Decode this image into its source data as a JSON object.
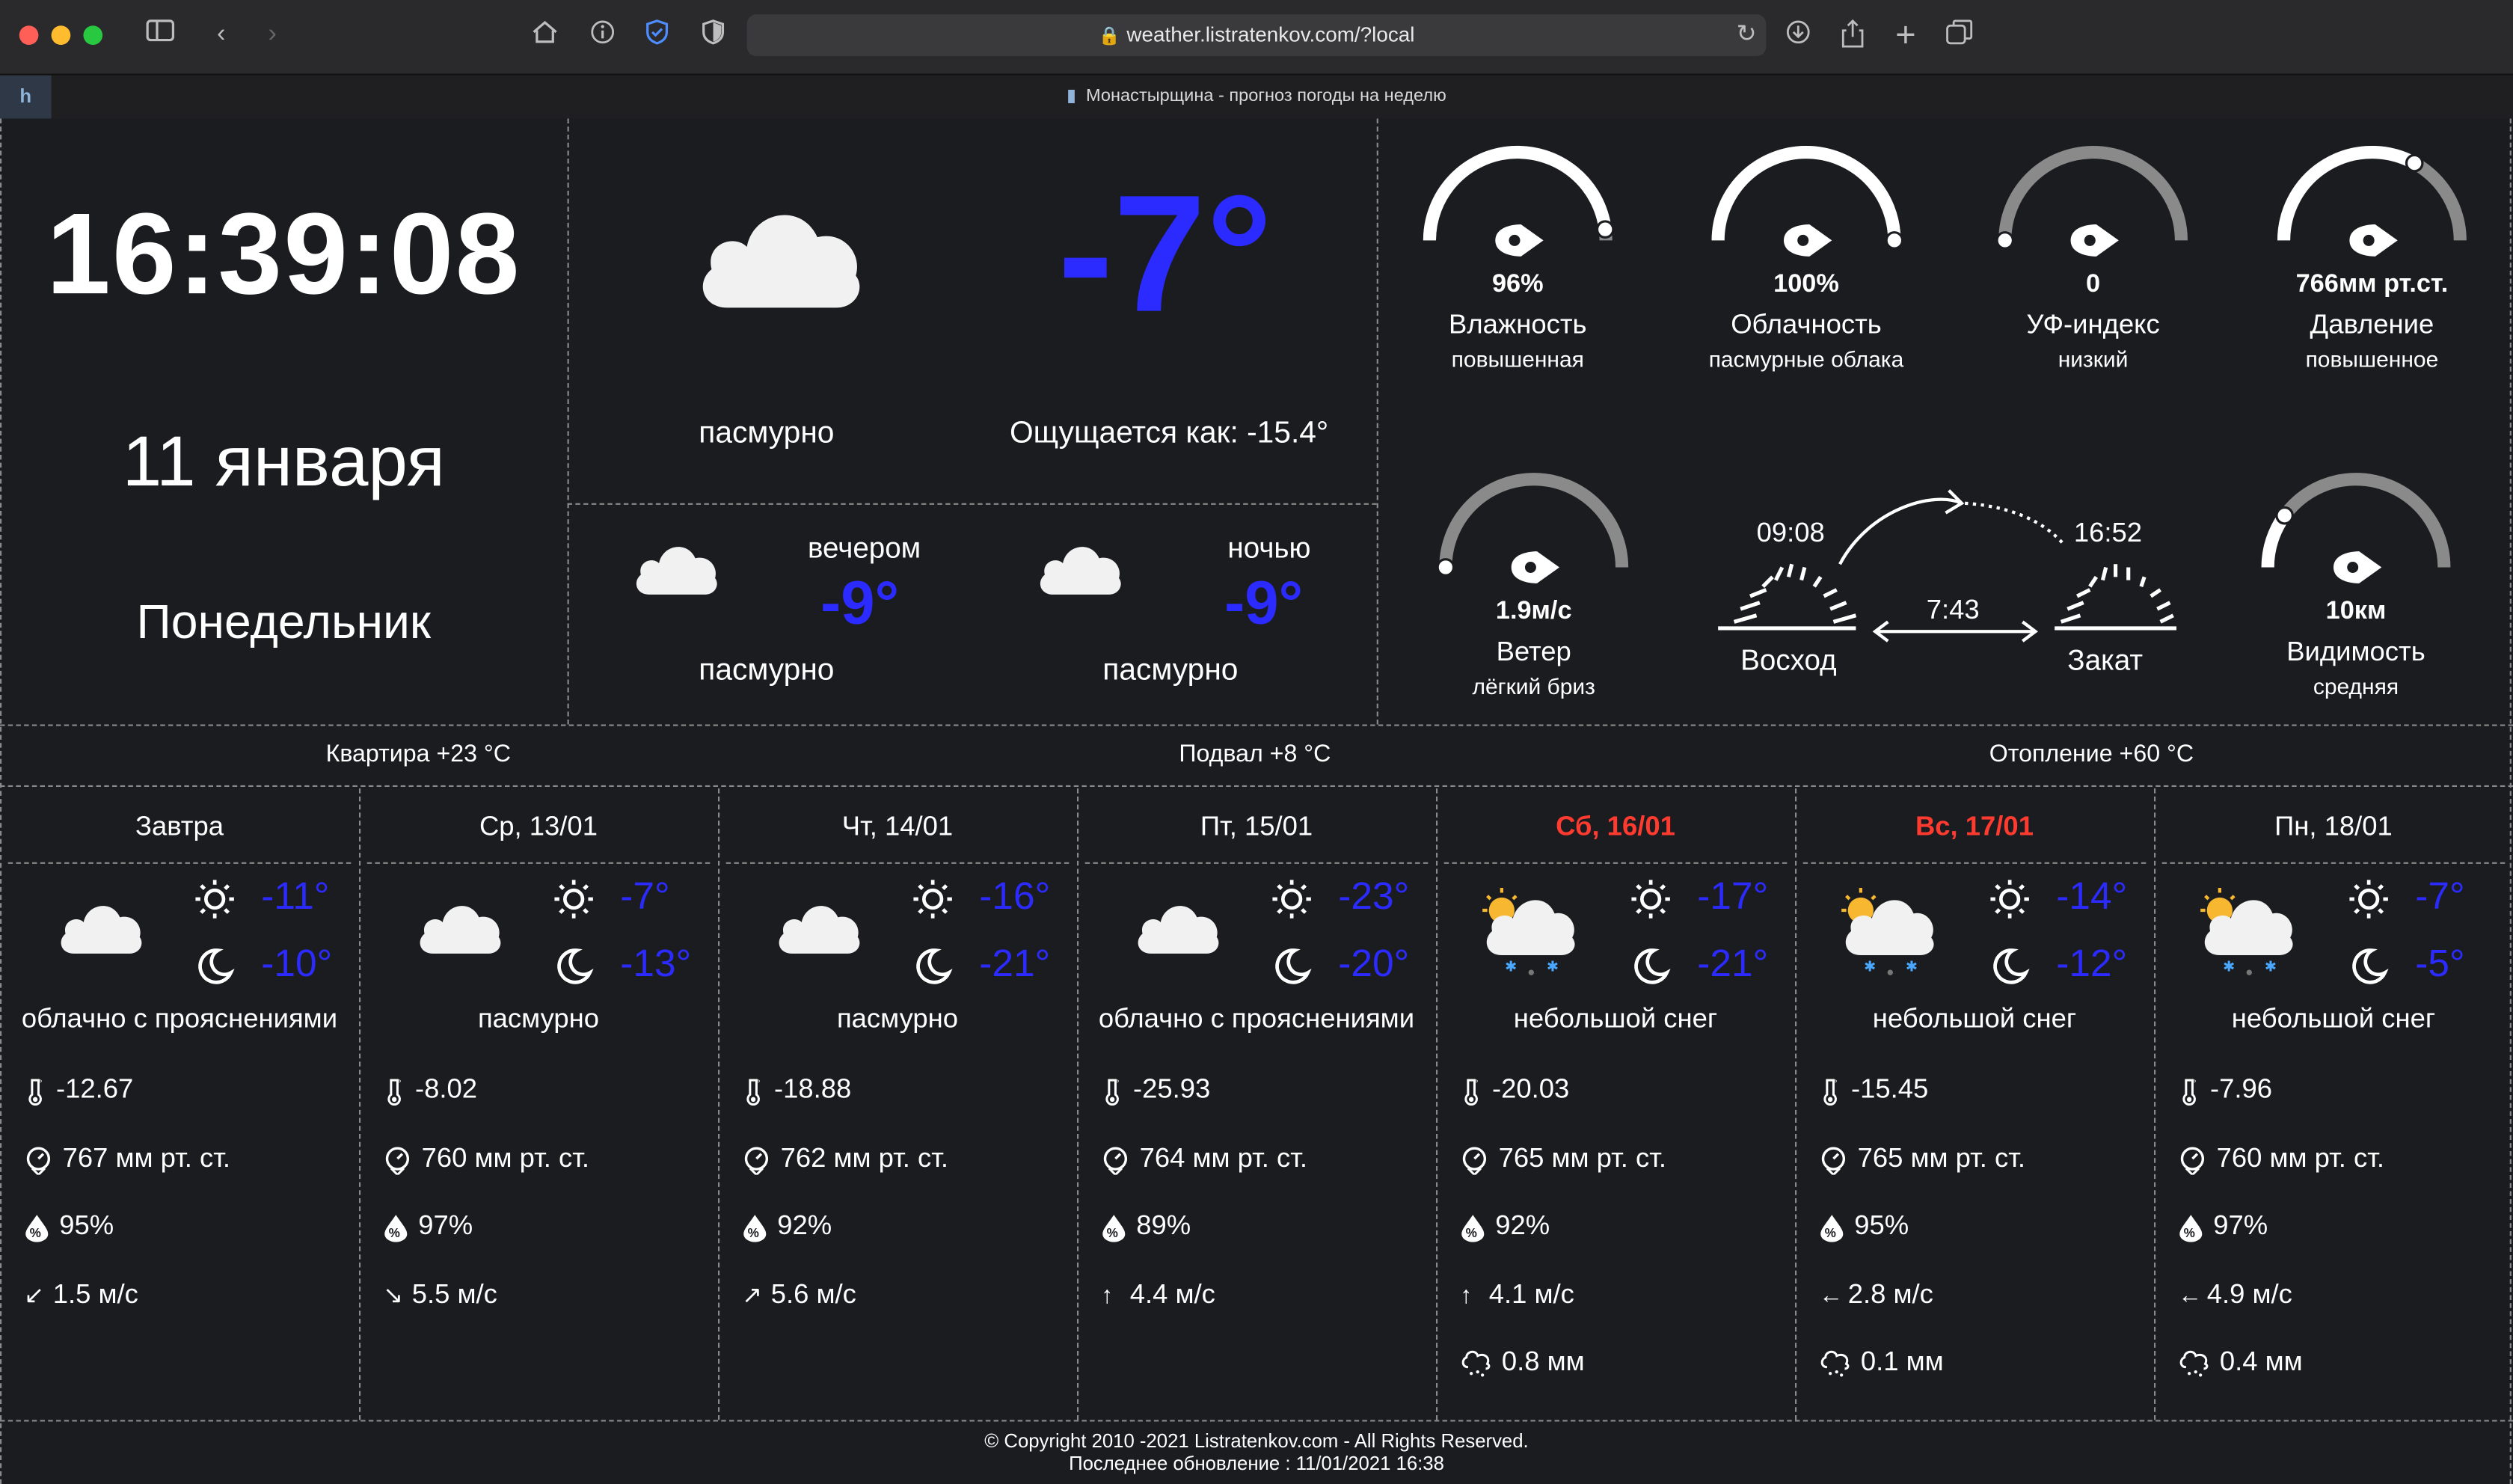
{
  "browser": {
    "url": "weather.listratenkov.com/?local",
    "tab_title": "Монастырщина - прогноз погоды на неделю",
    "tab_badge": "h"
  },
  "clock": {
    "time": "16:39:08",
    "date": "11 января",
    "weekday": "Понедельник"
  },
  "current": {
    "temp": "-7°",
    "condition": "пасмурно",
    "feels_like": "Ощущается как: -15.4°",
    "evening_label": "вечером",
    "evening_temp": "-9°",
    "evening_condition": "пасмурно",
    "night_label": "ночью",
    "night_temp": "-9°",
    "night_condition": "пасмурно"
  },
  "gauges": [
    {
      "value": "96%",
      "label": "Влажность",
      "sub": "повышенная",
      "fraction": 0.96
    },
    {
      "value": "100%",
      "label": "Облачность",
      "sub": "пасмурные облака",
      "fraction": 1.0
    },
    {
      "value": "0",
      "label": "УФ-индекс",
      "sub": "низкий",
      "fraction": 0.0
    },
    {
      "value": "766мм рт.ст.",
      "label": "Давление",
      "sub": "повышенное",
      "fraction": 0.66
    },
    {
      "value": "1.9м/с",
      "label": "Ветер",
      "sub": "лёгкий бриз",
      "fraction": 0.0
    },
    {
      "value": "10км",
      "label": "Видимость",
      "sub": "средняя",
      "fraction": 0.2
    }
  ],
  "sun": {
    "sunrise_time": "09:08",
    "sunset_time": "16:52",
    "day_length": "7:43",
    "sunrise_label": "Восход",
    "sunset_label": "Закат"
  },
  "sensors": [
    "Квартира +23 °С",
    "Подвал +8 °С",
    "Отопление +60 °С"
  ],
  "forecast": [
    {
      "day": "Завтра",
      "weekend": false,
      "icon": "cloud",
      "day_temp": "-11°",
      "night_temp": "-10°",
      "condition": "облачно с прояснениями",
      "feels": "-12.67",
      "pressure": "767 мм рт. ст.",
      "humidity": "95%",
      "wind_arrow": "↙",
      "wind": "1.5 м/с",
      "precip": ""
    },
    {
      "day": "Ср, 13/01",
      "weekend": false,
      "icon": "cloud",
      "day_temp": "-7°",
      "night_temp": "-13°",
      "condition": "пасмурно",
      "feels": "-8.02",
      "pressure": "760 мм рт. ст.",
      "humidity": "97%",
      "wind_arrow": "↘",
      "wind": "5.5 м/с",
      "precip": ""
    },
    {
      "day": "Чт, 14/01",
      "weekend": false,
      "icon": "cloud",
      "day_temp": "-16°",
      "night_temp": "-21°",
      "condition": "пасмурно",
      "feels": "-18.88",
      "pressure": "762 мм рт. ст.",
      "humidity": "92%",
      "wind_arrow": "↗",
      "wind": "5.6 м/с",
      "precip": ""
    },
    {
      "day": "Пт, 15/01",
      "weekend": false,
      "icon": "cloud",
      "day_temp": "-23°",
      "night_temp": "-20°",
      "condition": "облачно с прояснениями",
      "feels": "-25.93",
      "pressure": "764 мм рт. ст.",
      "humidity": "89%",
      "wind_arrow": "↑",
      "wind": "4.4 м/с",
      "precip": ""
    },
    {
      "day": "Сб, 16/01",
      "weekend": true,
      "icon": "snow",
      "day_temp": "-17°",
      "night_temp": "-21°",
      "condition": "небольшой снег",
      "feels": "-20.03",
      "pressure": "765 мм рт. ст.",
      "humidity": "92%",
      "wind_arrow": "↑",
      "wind": "4.1 м/с",
      "precip": "0.8 мм"
    },
    {
      "day": "Вс, 17/01",
      "weekend": true,
      "icon": "snow",
      "day_temp": "-14°",
      "night_temp": "-12°",
      "condition": "небольшой снег",
      "feels": "-15.45",
      "pressure": "765 мм рт. ст.",
      "humidity": "95%",
      "wind_arrow": "←",
      "wind": "2.8 м/с",
      "precip": "0.1 мм"
    },
    {
      "day": "Пн, 18/01",
      "weekend": false,
      "icon": "snow",
      "day_temp": "-7°",
      "night_temp": "-5°",
      "condition": "небольшой снег",
      "feels": "-7.96",
      "pressure": "760 мм рт. ст.",
      "humidity": "97%",
      "wind_arrow": "←",
      "wind": "4.9 м/с",
      "precip": "0.4 мм"
    }
  ],
  "footer": {
    "copyright": "© Copyright 2010 -2021 Listratenkov.com - All Rights Reserved.",
    "updated": "Последнее обновление : 11/01/2021 16:38"
  },
  "colors": {
    "accent_blue": "#2b2bff",
    "weekend_red": "#ff3b30",
    "background": "#1b1c20"
  }
}
